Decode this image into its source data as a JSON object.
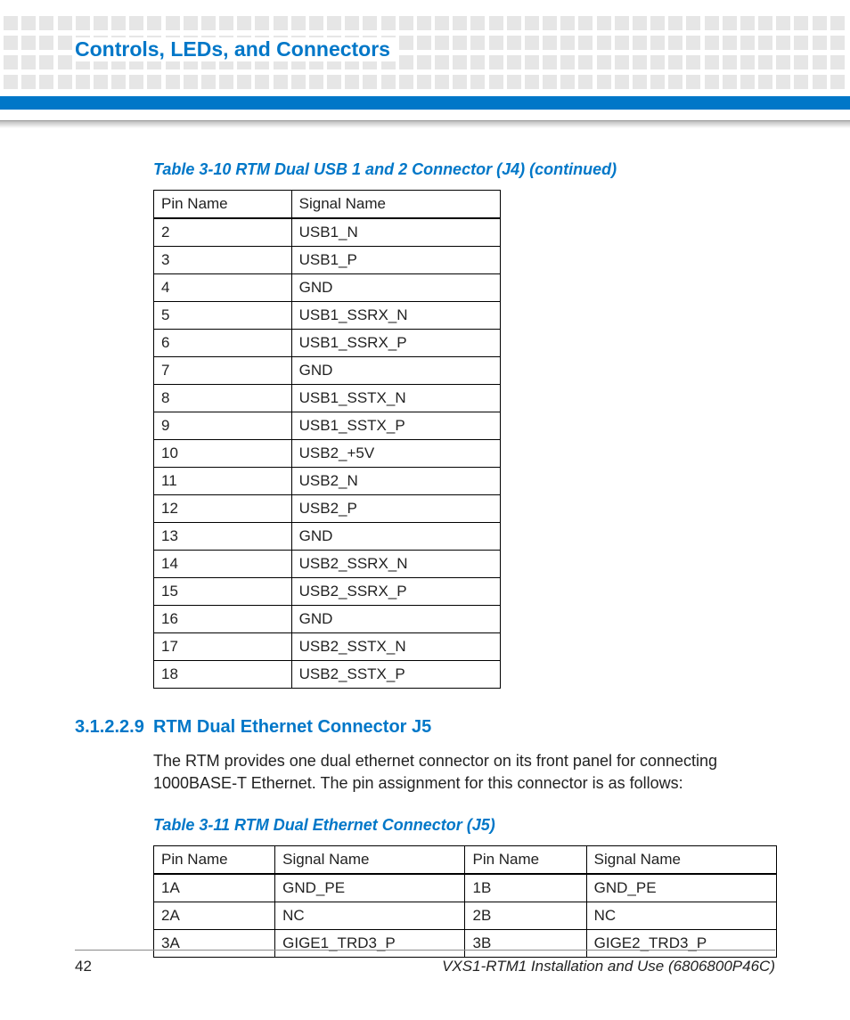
{
  "header": {
    "title": "Controls, LEDs, and Connectors"
  },
  "table310": {
    "caption": "Table 3-10 RTM Dual USB 1 and 2 Connector (J4)  (continued)",
    "cols": [
      "Pin Name",
      "Signal Name"
    ],
    "rows": [
      [
        "2",
        "USB1_N"
      ],
      [
        "3",
        "USB1_P"
      ],
      [
        "4",
        "GND"
      ],
      [
        "5",
        "USB1_SSRX_N"
      ],
      [
        "6",
        "USB1_SSRX_P"
      ],
      [
        "7",
        "GND"
      ],
      [
        "8",
        "USB1_SSTX_N"
      ],
      [
        "9",
        "USB1_SSTX_P"
      ],
      [
        "10",
        "USB2_+5V"
      ],
      [
        "11",
        "USB2_N"
      ],
      [
        "12",
        "USB2_P"
      ],
      [
        "13",
        "GND"
      ],
      [
        "14",
        "USB2_SSRX_N"
      ],
      [
        "15",
        "USB2_SSRX_P"
      ],
      [
        "16",
        "GND"
      ],
      [
        "17",
        "USB2_SSTX_N"
      ],
      [
        "18",
        "USB2_SSTX_P"
      ]
    ]
  },
  "section": {
    "number": "3.1.2.2.9",
    "title": "RTM Dual Ethernet Connector J5",
    "body": "The RTM provides one dual ethernet connector on its front panel for connecting 1000BASE-T Ethernet. The pin assignment for this connector is as follows:"
  },
  "table311": {
    "caption": "Table 3-11 RTM Dual Ethernet Connector (J5)",
    "cols": [
      "Pin Name",
      "Signal Name",
      "Pin Name",
      "Signal Name"
    ],
    "rows": [
      [
        "1A",
        "GND_PE",
        "1B",
        "GND_PE"
      ],
      [
        "2A",
        "NC",
        "2B",
        "NC"
      ],
      [
        "3A",
        "GIGE1_TRD3_P",
        "3B",
        "GIGE2_TRD3_P"
      ]
    ]
  },
  "footer": {
    "page": "42",
    "doc": "VXS1-RTM1 Installation and Use (6806800P46C)"
  }
}
